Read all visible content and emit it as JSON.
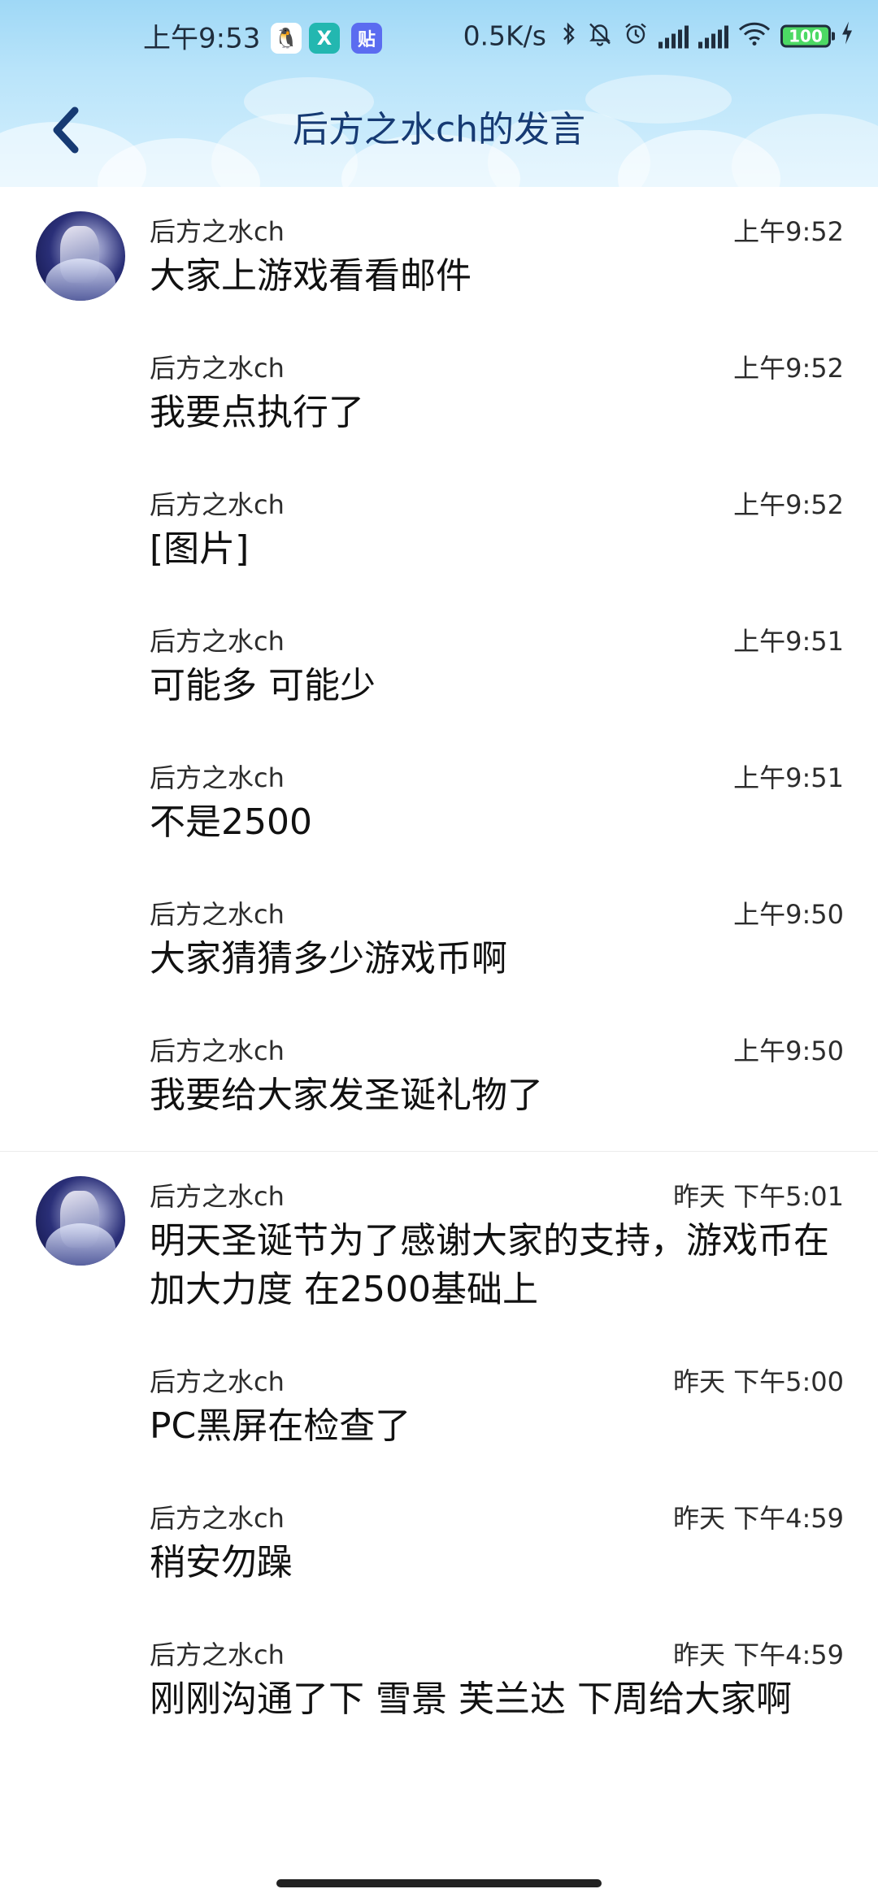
{
  "status_bar": {
    "time": "上午9:53",
    "net_speed": "0.5K/s",
    "battery": "100",
    "apps": [
      {
        "name": "qq-icon",
        "glyph": "🐧"
      },
      {
        "name": "x-app-icon",
        "glyph": "X"
      },
      {
        "name": "tieba-icon",
        "glyph": "贴"
      }
    ]
  },
  "header": {
    "title": "后方之水ch的发言",
    "back_icon": "chevron-left-icon",
    "accent": "#163a73",
    "background": "#b9e4fa"
  },
  "groups": [
    {
      "messages": [
        {
          "sender": "后方之水ch",
          "time": "上午9:52",
          "text": "大家上游戏看看邮件"
        },
        {
          "sender": "后方之水ch",
          "time": "上午9:52",
          "text": "我要点执行了"
        },
        {
          "sender": "后方之水ch",
          "time": "上午9:52",
          "text": "[图片]"
        },
        {
          "sender": "后方之水ch",
          "time": "上午9:51",
          "text": "可能多 可能少"
        },
        {
          "sender": "后方之水ch",
          "time": "上午9:51",
          "text": "不是2500"
        },
        {
          "sender": "后方之水ch",
          "time": "上午9:50",
          "text": "大家猜猜多少游戏币啊"
        },
        {
          "sender": "后方之水ch",
          "time": "上午9:50",
          "text": "我要给大家发圣诞礼物了"
        }
      ]
    },
    {
      "messages": [
        {
          "sender": "后方之水ch",
          "time": "昨天 下午5:01",
          "text": "明天圣诞节为了感谢大家的支持，游戏币在加大力度 在2500基础上"
        },
        {
          "sender": "后方之水ch",
          "time": "昨天 下午5:00",
          "text": "PC黑屏在检查了"
        },
        {
          "sender": "后方之水ch",
          "time": "昨天 下午4:59",
          "text": "稍安勿躁"
        },
        {
          "sender": "后方之水ch",
          "time": "昨天 下午4:59",
          "text": "刚刚沟通了下  雪景 芙兰达 下周给大家啊"
        }
      ]
    }
  ]
}
